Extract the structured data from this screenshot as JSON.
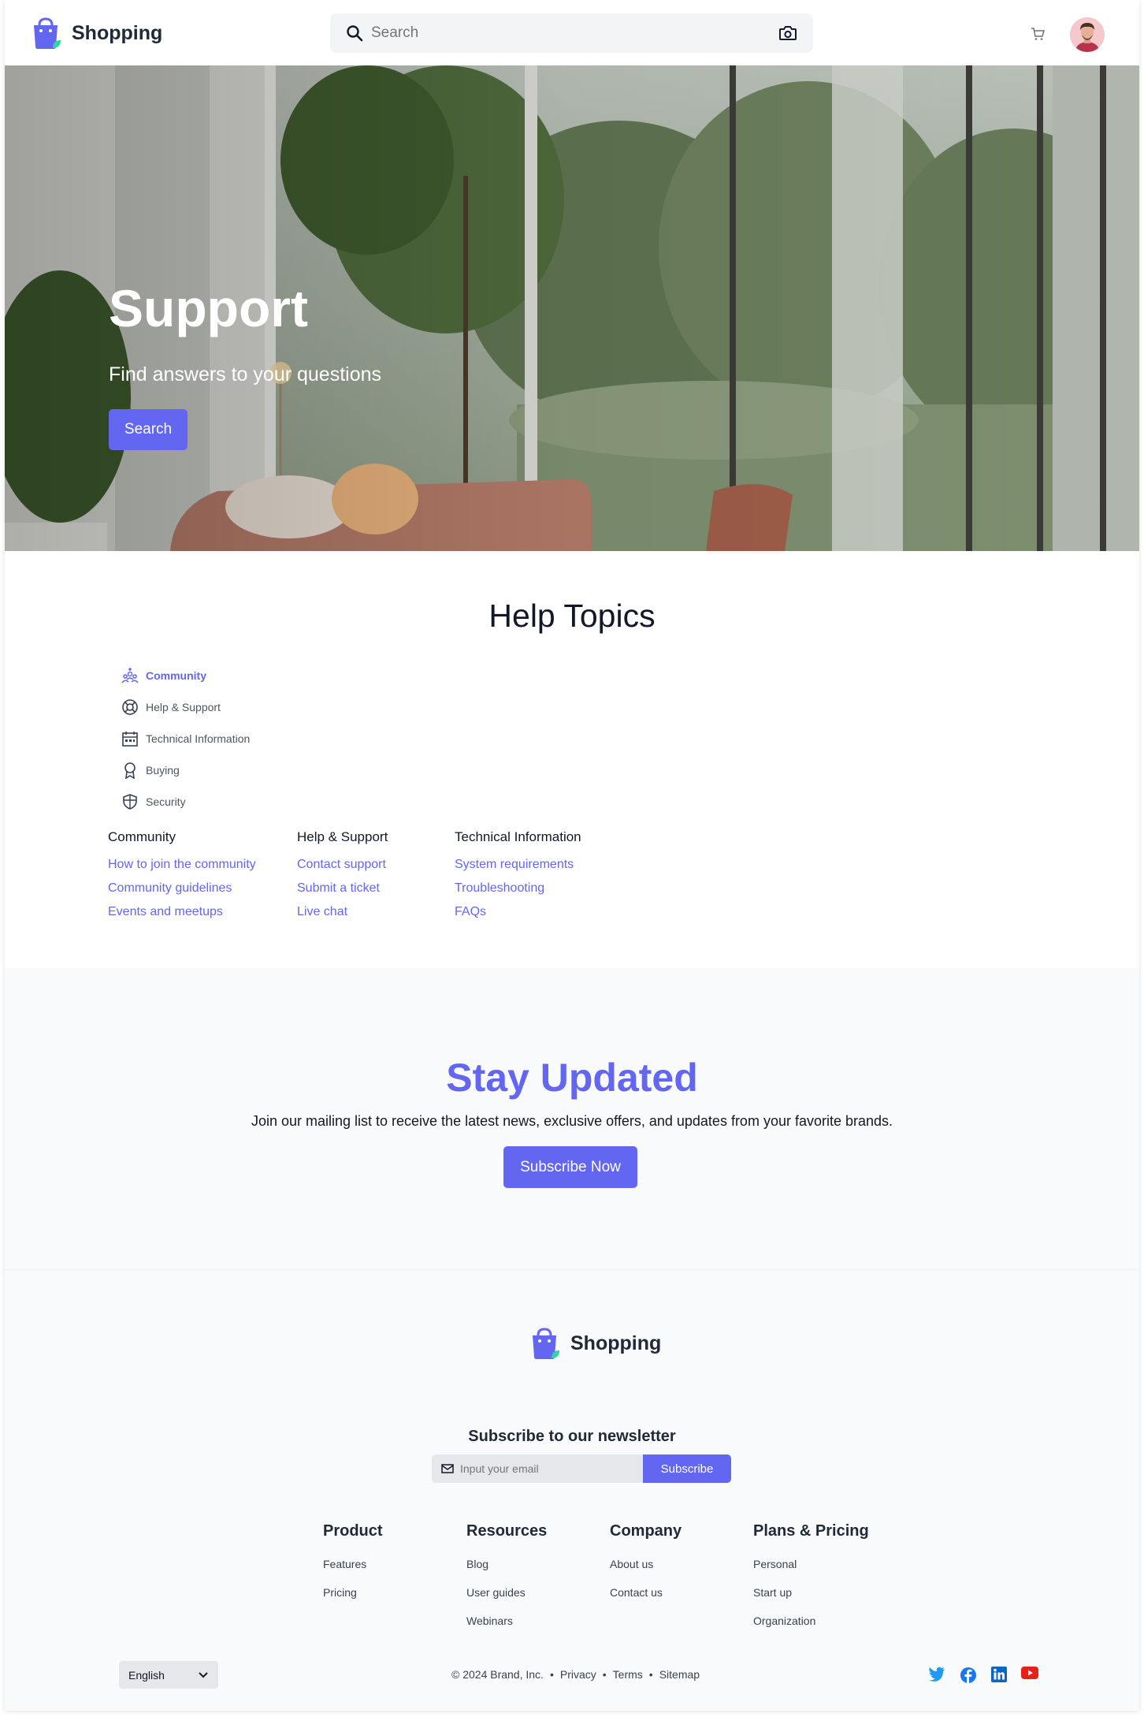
{
  "header": {
    "logo_text": "Shopping",
    "search_placeholder": "Search"
  },
  "hero": {
    "title": "Support",
    "subtitle": "Find answers to your questions",
    "button": "Search"
  },
  "help": {
    "title": "Help Topics",
    "topics": [
      {
        "label": "Community",
        "icon": "community-icon",
        "active": true
      },
      {
        "label": "Help & Support",
        "icon": "lifebuoy-icon",
        "active": false
      },
      {
        "label": "Technical Information",
        "icon": "calendar-icon",
        "active": false
      },
      {
        "label": "Buying",
        "icon": "award-icon",
        "active": false
      },
      {
        "label": "Security",
        "icon": "shield-icon",
        "active": false
      }
    ],
    "columns": [
      {
        "title": "Community",
        "links": [
          "How to join the community",
          "Community guidelines",
          "Events and meetups"
        ]
      },
      {
        "title": "Help & Support",
        "links": [
          "Contact support",
          "Submit a ticket",
          "Live chat"
        ]
      },
      {
        "title": "Technical Information",
        "links": [
          "System requirements",
          "Troubleshooting",
          "FAQs"
        ]
      }
    ]
  },
  "stay": {
    "title": "Stay Updated",
    "subtitle": "Join our mailing list to receive the latest news, exclusive offers, and updates from your favorite brands.",
    "button": "Subscribe Now"
  },
  "footer": {
    "logo_text": "Shopping",
    "newsletter_title": "Subscribe to our newsletter",
    "email_placeholder": "Input your email",
    "subscribe_button": "Subscribe",
    "columns": [
      {
        "title": "Product",
        "links": [
          "Features",
          "Pricing"
        ]
      },
      {
        "title": "Resources",
        "links": [
          "Blog",
          "User guides",
          "Webinars"
        ]
      },
      {
        "title": "Company",
        "links": [
          "About us",
          "Contact us"
        ]
      },
      {
        "title": "Plans & Pricing",
        "links": [
          "Personal",
          "Start up",
          "Organization"
        ]
      }
    ],
    "language": "English",
    "copyright": "© 2024 Brand, Inc.",
    "legal_links": [
      "Privacy",
      "Terms",
      "Sitemap"
    ],
    "socials": [
      "twitter-icon",
      "facebook-icon",
      "linkedin-icon",
      "youtube-icon"
    ]
  },
  "colors": {
    "accent": "#6366f1",
    "footer_bg": "#f9fafb"
  }
}
